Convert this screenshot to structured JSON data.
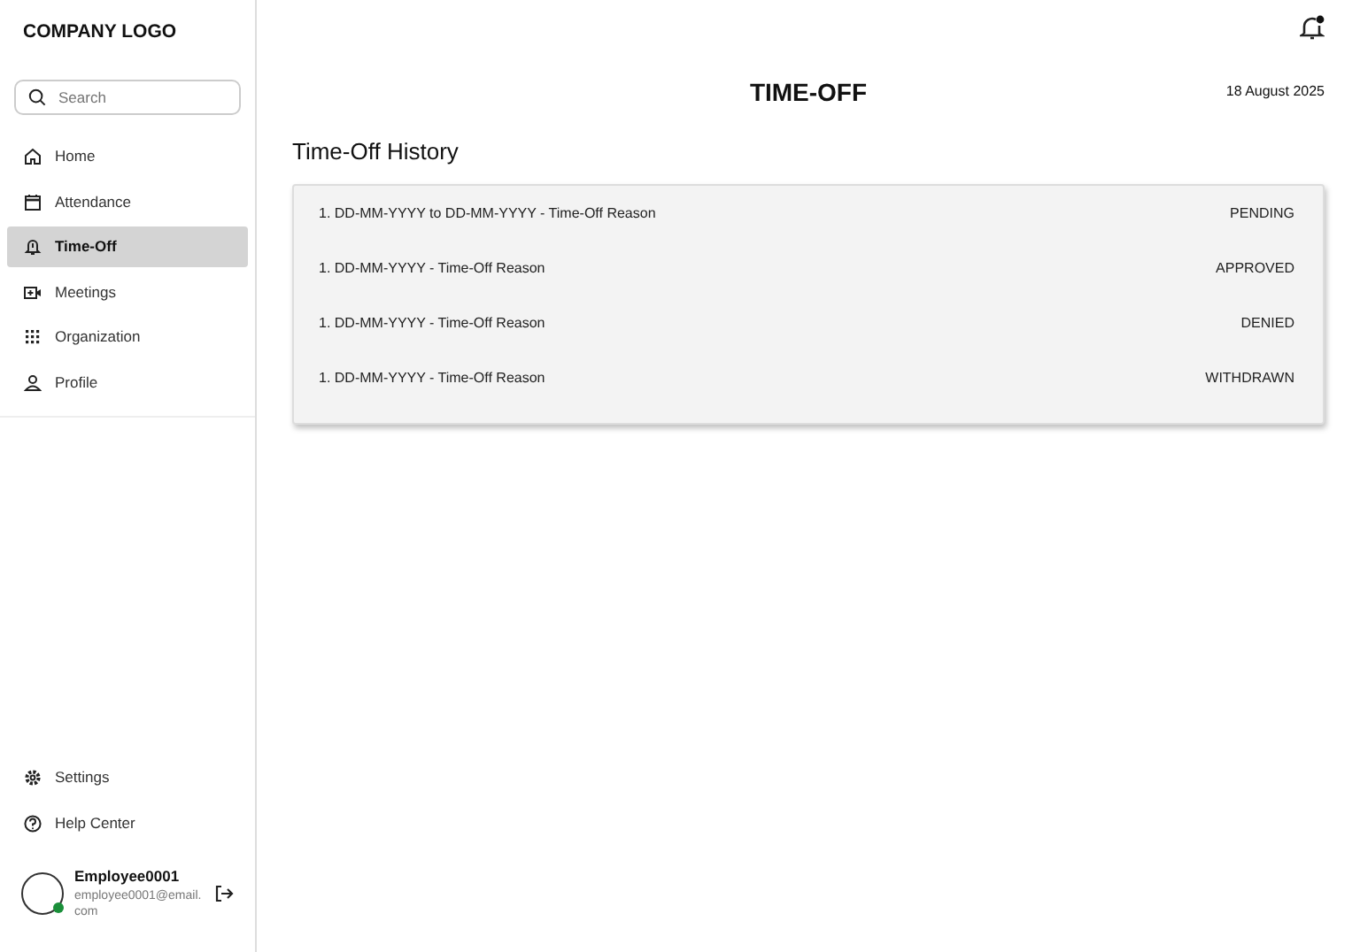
{
  "sidebar": {
    "logo": "COMPANY LOGO",
    "search": {
      "placeholder": "Search"
    },
    "items": [
      {
        "label": "Home",
        "selected": false
      },
      {
        "label": "Attendance",
        "selected": false
      },
      {
        "label": "Time-Off",
        "selected": true
      },
      {
        "label": "Meetings",
        "selected": false
      },
      {
        "label": "Organization",
        "selected": false
      },
      {
        "label": "Profile",
        "selected": false
      }
    ],
    "bottom_items": [
      {
        "label": "Settings"
      },
      {
        "label": "Help Center"
      }
    ],
    "user": {
      "name": "Employee0001",
      "email": "employee0001@email.com",
      "online": true
    }
  },
  "header": {
    "title": "TIME-OFF",
    "date": "18 August 2025",
    "notifications_unread": true
  },
  "history": {
    "title": "Time-Off History",
    "rows": [
      {
        "text": "1. DD-MM-YYYY to DD-MM-YYYY - Time-Off Reason",
        "status": "PENDING"
      },
      {
        "text": "1. DD-MM-YYYY - Time-Off Reason",
        "status": "APPROVED"
      },
      {
        "text": "1. DD-MM-YYYY - Time-Off Reason",
        "status": "DENIED"
      },
      {
        "text": "1. DD-MM-YYYY - Time-Off Reason",
        "status": "WITHDRAWN"
      }
    ]
  }
}
